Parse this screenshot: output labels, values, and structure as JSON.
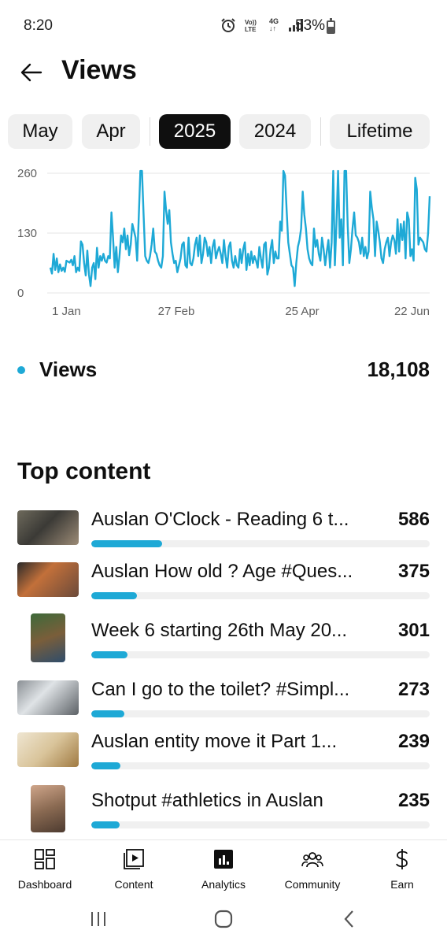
{
  "status_bar": {
    "time": "8:20",
    "battery_text": "53%",
    "network_label": "4G"
  },
  "header": {
    "title": "Views",
    "back_icon": "arrow-left-icon"
  },
  "period_chips": [
    {
      "label": "May",
      "selected": false
    },
    {
      "label": "Apr",
      "selected": false
    },
    {
      "label": "2025",
      "selected": true
    },
    {
      "label": "2024",
      "selected": false
    },
    {
      "label": "Lifetime",
      "selected": false
    }
  ],
  "chart_data": {
    "type": "line",
    "title": "",
    "xlabel": "",
    "ylabel": "",
    "ylim": [
      0,
      260
    ],
    "yticks": [
      "260",
      "130",
      "0"
    ],
    "xticks": [
      "1 Jan",
      "27 Feb",
      "25 Apr",
      "22 Jun"
    ],
    "grid": true,
    "color": "#1ea9d6",
    "series": [
      {
        "values": [
          55,
          42,
          85,
          50,
          75,
          45,
          62,
          48,
          55,
          46,
          70,
          68,
          66,
          72,
          60,
          80,
          45,
          55,
          48,
          112,
          105,
          65,
          38,
          92,
          40,
          15,
          55,
          65,
          30,
          98,
          55,
          80,
          70,
          85,
          70,
          66,
          80,
          75,
          175,
          120,
          55,
          100,
          45,
          80,
          125,
          110,
          140,
          95,
          125,
          82,
          105,
          150,
          135,
          120,
          70,
          165,
          268,
          275,
          170,
          80,
          70,
          65,
          80,
          105,
          140,
          90,
          85,
          70,
          60,
          55,
          80,
          220,
          180,
          150,
          180,
          110,
          85,
          65,
          70,
          45,
          60,
          75,
          105,
          110,
          60,
          55,
          120,
          65,
          60,
          75,
          105,
          120,
          80,
          125,
          65,
          85,
          120,
          110,
          80,
          100,
          65,
          100,
          115,
          75,
          90,
          100,
          85,
          65,
          115,
          80,
          55,
          100,
          110,
          70,
          55,
          80,
          60,
          55,
          95,
          65,
          95,
          110,
          50,
          85,
          60,
          90,
          65,
          80,
          70,
          55,
          100,
          75,
          55,
          105,
          110,
          40,
          55,
          95,
          115,
          65,
          90,
          75,
          75,
          155,
          135,
          275,
          255,
          180,
          110,
          85,
          60,
          55,
          15,
          65,
          100,
          115,
          140,
          220,
          170,
          140,
          95,
          75,
          65,
          60,
          140,
          100,
          115,
          85,
          70,
          120,
          95,
          60,
          90,
          115,
          55,
          110,
          275,
          60,
          150,
          280,
          120,
          160,
          60,
          275,
          265,
          145,
          65,
          95,
          140,
          175,
          125,
          120,
          110,
          85,
          120,
          80,
          100,
          75,
          90,
          220,
          185,
          160,
          80,
          155,
          135,
          110,
          75,
          65,
          95,
          110,
          120,
          80,
          110,
          125,
          115,
          85,
          160,
          90,
          150,
          115,
          155,
          75,
          175,
          160,
          80,
          95,
          70,
          250,
          225,
          105,
          120,
          115,
          110,
          95,
          90,
          130,
          210
        ]
      }
    ]
  },
  "totals": {
    "metric_label": "Views",
    "metric_value": "18,108",
    "dot_color": "#1ea9d6"
  },
  "top_content": {
    "title": "Top content",
    "max_value": 2800,
    "items": [
      {
        "title": "Auslan O'Clock - Reading 6 t...",
        "value": "586",
        "views": 586
      },
      {
        "title": "Auslan How old ? Age #Ques...",
        "value": "375",
        "views": 375
      },
      {
        "title": "Week 6 starting 26th May 20...",
        "value": "301",
        "views": 301
      },
      {
        "title": "Can I go to the toilet? #Simpl...",
        "value": "273",
        "views": 273
      },
      {
        "title": "Auslan entity move it Part 1...",
        "value": "239",
        "views": 239
      },
      {
        "title": "Shotput  #athletics in Auslan",
        "value": "235",
        "views": 235
      }
    ]
  },
  "bottom_nav": [
    {
      "label": "Dashboard",
      "icon": "dashboard-icon"
    },
    {
      "label": "Content",
      "icon": "content-play-icon"
    },
    {
      "label": "Analytics",
      "icon": "analytics-icon",
      "active": true
    },
    {
      "label": "Community",
      "icon": "community-icon"
    },
    {
      "label": "Earn",
      "icon": "dollar-icon"
    }
  ],
  "system_nav": {
    "recents": "recents-icon",
    "home": "home-icon",
    "back": "back-icon"
  }
}
